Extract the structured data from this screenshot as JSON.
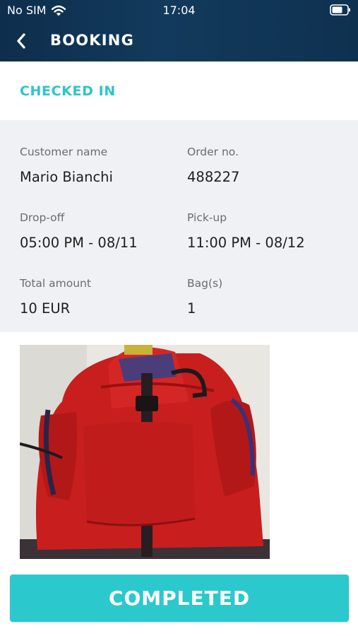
{
  "status_bar": {
    "carrier": "No SIM",
    "time": "17:04",
    "wifi_icon": "wifi-icon",
    "battery_icon": "battery-icon"
  },
  "nav": {
    "title": "BOOKING",
    "back_icon": "chevron-left-icon"
  },
  "booking": {
    "status": "CHECKED IN",
    "status_color": "#2cc5cb",
    "fields": {
      "customer_name": {
        "label": "Customer name",
        "value": "Mario Bianchi"
      },
      "order_no": {
        "label": "Order no.",
        "value": "488227"
      },
      "drop_off": {
        "label": "Drop-off",
        "value": "05:00 PM - 08/11"
      },
      "pick_up": {
        "label": "Pick-up",
        "value": "11:00 PM - 08/12"
      },
      "total_amount": {
        "label": "Total amount",
        "value": "10 EUR"
      },
      "bags": {
        "label": "Bag(s)",
        "value": "1"
      }
    },
    "photo": "luggage-photo"
  },
  "actions": {
    "complete_label": "COMPLETED",
    "accent_color": "#2bc8cd"
  },
  "colors": {
    "header_background": "#123a5c",
    "details_background": "#f0f1f4"
  }
}
